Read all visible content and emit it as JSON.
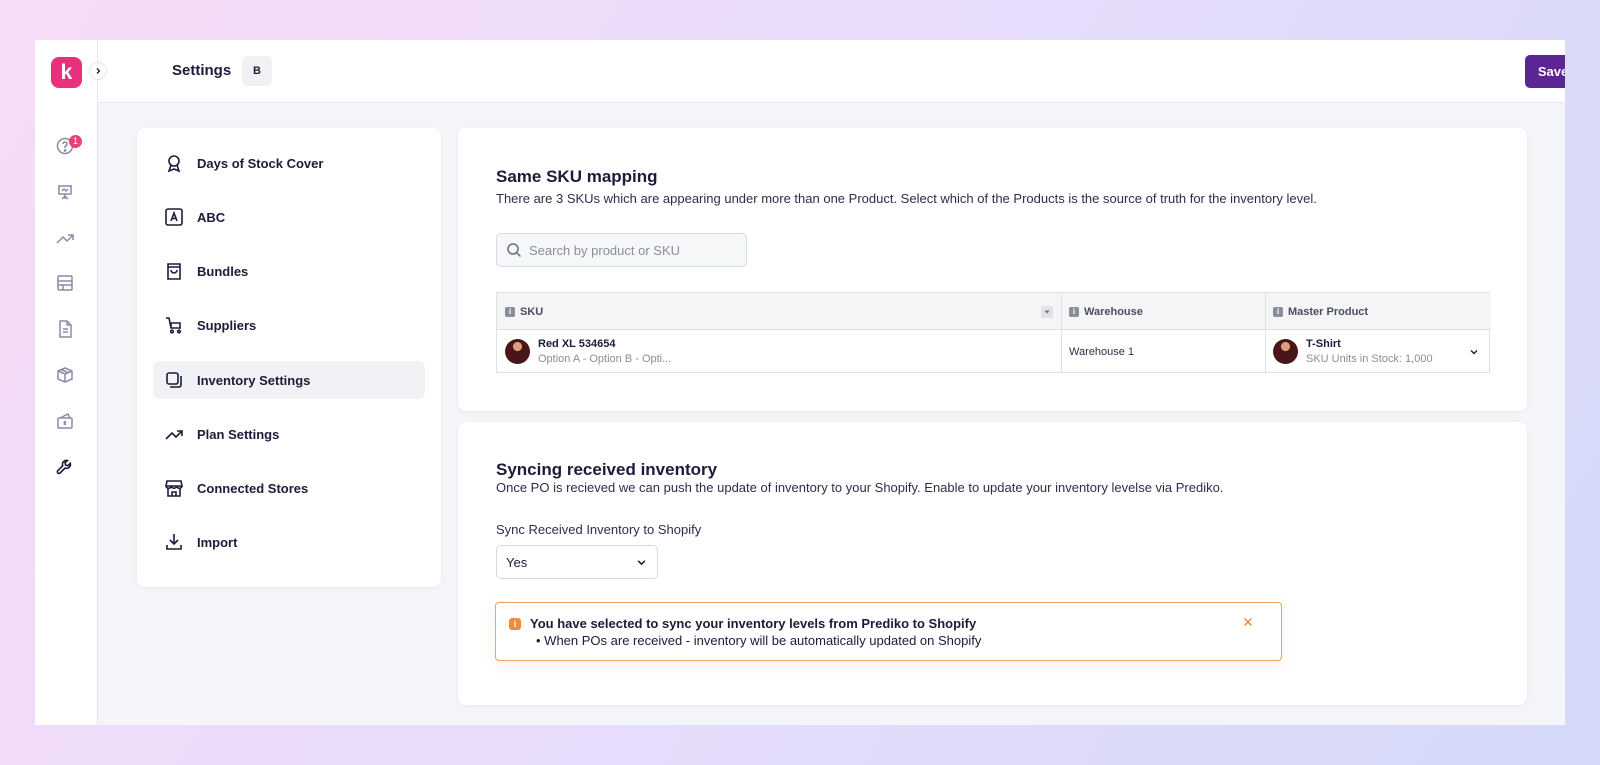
{
  "header": {
    "title": "Settings",
    "chip": "B",
    "save_label": "Save"
  },
  "rail": {
    "logo": "k",
    "help_badge": "1",
    "icons": [
      "help-icon",
      "presentation-icon",
      "trend-up-icon",
      "calendar-grid-icon",
      "document-icon",
      "box-icon",
      "cash-icon",
      "wrench-icon"
    ]
  },
  "menu": {
    "items": [
      {
        "label": "Days of Stock Cover",
        "icon": "award-icon"
      },
      {
        "label": "ABC",
        "icon": "letter-a-icon"
      },
      {
        "label": "Bundles",
        "icon": "shopping-bag-icon"
      },
      {
        "label": "Suppliers",
        "icon": "cart-icon"
      },
      {
        "label": "Inventory Settings",
        "icon": "copy-icon"
      },
      {
        "label": "Plan Settings",
        "icon": "trend-icon"
      },
      {
        "label": "Connected Stores",
        "icon": "store-icon"
      },
      {
        "label": "Import",
        "icon": "download-icon"
      }
    ],
    "active_index": 4
  },
  "sku": {
    "title": "Same SKU mapping",
    "description": "There are 3 SKUs which are appearing under more than one Product. Select which of the Products is the source of truth for the inventory level.",
    "search_placeholder": "Search by product or SKU",
    "columns": [
      "SKU",
      "Warehouse",
      "Master Product"
    ],
    "rows": [
      {
        "sku_name": "Red XL 534654",
        "sku_options": "Option A - Option B - Opti...",
        "warehouse": "Warehouse 1",
        "product_name": "T-Shirt",
        "product_stock": "SKU Units in Stock: 1,000"
      }
    ]
  },
  "sync": {
    "title": "Syncing received inventory",
    "description": "Once PO is recieved we can push the update of inventory to your Shopify. Enable to update your inventory levelse via Prediko.",
    "field_label": "Sync Received Inventory to Shopify",
    "selected": "Yes",
    "alert_title": "You have selected to sync your inventory levels from Prediko to Shopify",
    "alert_body": "When POs are received - inventory will be automatically updated on Shopify"
  },
  "colors": {
    "accent": "#5b2694",
    "brand": "#e8307c",
    "alert": "#f08a3c"
  }
}
